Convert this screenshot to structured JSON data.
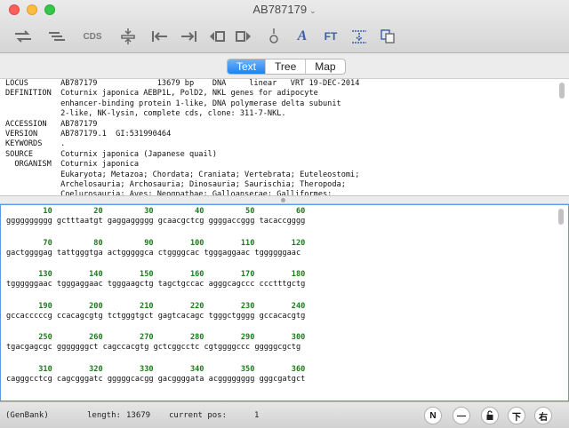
{
  "window": {
    "title": "AB787179"
  },
  "toolbar": {
    "buttons": [
      {
        "name": "swap-icon",
        "label": ""
      },
      {
        "name": "align-lines-icon",
        "label": ""
      },
      {
        "name": "cds-button",
        "label": "CDS"
      },
      {
        "name": "insert-icon",
        "label": ""
      },
      {
        "name": "go-start-icon",
        "label": ""
      },
      {
        "name": "go-end-icon",
        "label": ""
      },
      {
        "name": "select-left-icon",
        "label": ""
      },
      {
        "name": "select-right-icon",
        "label": ""
      },
      {
        "name": "origin-icon",
        "label": ""
      },
      {
        "name": "font-icon",
        "label": "A"
      },
      {
        "name": "ft-button",
        "label": "FT"
      },
      {
        "name": "format-icon",
        "label": ""
      },
      {
        "name": "copy-icon",
        "label": ""
      }
    ]
  },
  "tabs": {
    "text": "Text",
    "tree": "Tree",
    "map": "Map",
    "selected": "Text"
  },
  "record_lines": [
    "LOCUS       AB787179             13679 bp    DNA     linear   VRT 19-DEC-2014",
    "DEFINITION  Coturnix japonica AEBP1L, PolD2, NKL genes for adipocyte",
    "            enhancer-binding protein 1-like, DNA polymerase delta subunit",
    "            2-like, NK-lysin, complete cds, clone: 311-7-NKL.",
    "ACCESSION   AB787179",
    "VERSION     AB787179.1  GI:531990464",
    "KEYWORDS    .",
    "SOURCE      Coturnix japonica (Japanese quail)",
    "  ORGANISM  Coturnix japonica",
    "            Eukaryota; Metazoa; Chordata; Craniata; Vertebrata; Euteleostomi;",
    "            Archelosauria; Archosauria; Dinosauria; Saurischia; Theropoda;",
    "            Coelurosauria; Aves; Neognathae; Galloanserae; Galliformes;"
  ],
  "sequence_rows": [
    {
      "nums": "        10         20         30         40         50         60",
      "bases": "gggggggggg gctttaatgt gaggaggggg gcaacgctcg ggggaccggg tacaccgggg"
    },
    {
      "nums": "        70         80         90        100        110        120",
      "bases": "gactggggag tattgggtga actgggggca ctggggcac tgggaggaac tggggggaac"
    },
    {
      "nums": "       130        140        150        160        170        180",
      "bases": "tggggggaac tgggaggaac tgggaagctg tagctgccac agggcagccc ccctttgctg"
    },
    {
      "nums": "       190        200        210        220        230        240",
      "bases": "gccacccccg ccacagcgtg tctgggtgct gagtcacagc tgggctgggg gccacacgtg"
    },
    {
      "nums": "       250        260        270        280        290        300",
      "bases": "tgacgagcgc gggggggct cagccacgtg gctcggcctc cgtggggccc gggggcgctg"
    },
    {
      "nums": "       310        320        330        340        350        360",
      "bases": "cagggcctcg cagcgggatc gggggcacgg gacggggata acgggggggg gggcgatgct"
    }
  ],
  "status": {
    "format": "(GenBank)",
    "length_label": "length:",
    "length_value": "13679",
    "pos_label": "current pos:",
    "pos_value": "1",
    "buttons": [
      "N",
      "—",
      "",
      "下",
      "右"
    ]
  }
}
